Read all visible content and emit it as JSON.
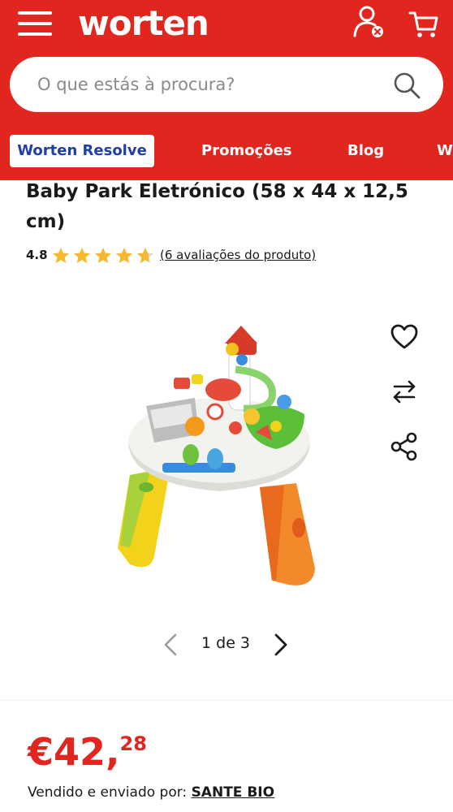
{
  "header": {
    "logo_text": "worten",
    "brand_color": "#e0261f",
    "menu_icon": "hamburger-menu-icon",
    "account_icon": "user-account-icon",
    "cart_icon": "shopping-cart-icon"
  },
  "search": {
    "placeholder": "O que estás à procura?",
    "icon": "search-icon"
  },
  "nav": {
    "items": [
      {
        "label": "Worten Resolve"
      },
      {
        "label": "Promoções"
      },
      {
        "label": "Blog"
      },
      {
        "label": "W"
      }
    ]
  },
  "product": {
    "title": "Baby Park Eletrónico (58 x 44 x 12,5 cm)",
    "rating": "4.8",
    "rating_fraction": 0.96,
    "reviews_label": "(6 avaliações do produto)",
    "image_icon": "baby-activity-table-image"
  },
  "actions": [
    {
      "icon": "heart-icon"
    },
    {
      "icon": "compare-arrows-icon"
    },
    {
      "icon": "share-icon"
    }
  ],
  "pager": {
    "text": "1 de 3"
  },
  "price": {
    "main": "€42,",
    "cents": "28"
  },
  "seller": {
    "prefix": "Vendido e enviado por:",
    "name": "SANTE BIO"
  }
}
